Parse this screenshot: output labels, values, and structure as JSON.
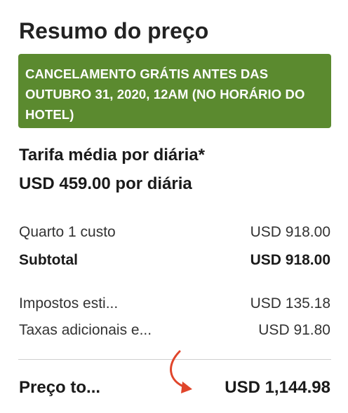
{
  "summary": {
    "title": "Resumo do preço",
    "cancellation_banner": "CANCELAMENTO GRÁTIS ANTES DAS OUTUBRO 31, 2020, 12AM (NO HORÁRIO DO HOTEL)",
    "banner_color": "#5b8a2f",
    "average_rate_label": "Tarifa média por diária*",
    "average_rate_value": "USD 459.00 por diária"
  },
  "lines": {
    "room": {
      "label": "Quarto 1 custo",
      "value": "USD 918.00"
    },
    "subtotal": {
      "label": "Subtotal",
      "value": "USD 918.00"
    },
    "taxes": {
      "label": "Impostos esti...",
      "value": "USD 135.18"
    },
    "fees": {
      "label": "Taxas adicionais e...",
      "value": "USD 91.80"
    }
  },
  "total": {
    "label": "Preço to...",
    "value": "USD 1,144.98"
  },
  "annotation": {
    "arrow_color": "#e0452b"
  }
}
